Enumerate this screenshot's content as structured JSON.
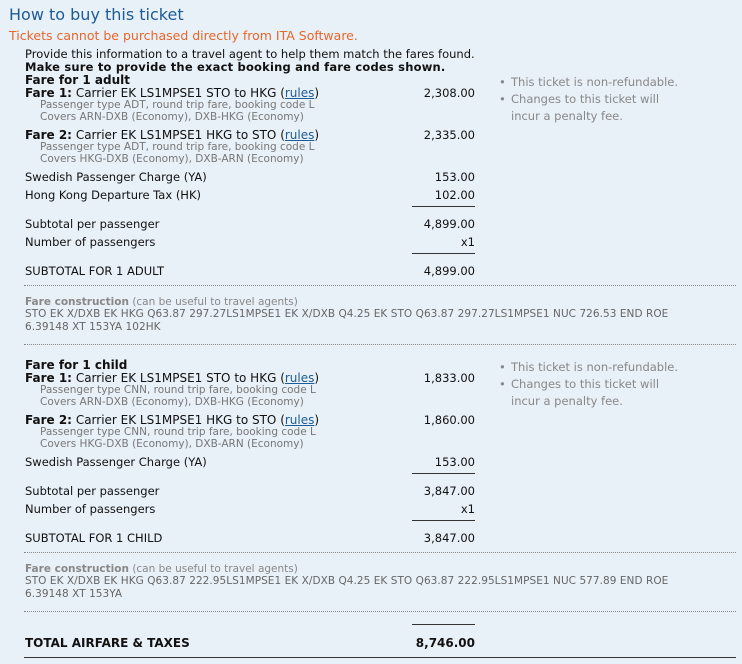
{
  "title": "How to buy this ticket",
  "warning": "Tickets cannot be purchased directly from ITA Software.",
  "intro": {
    "line1": "Provide this information to a travel agent to help them match the fares found.",
    "line2": "Make sure to provide the exact booking and fare codes shown."
  },
  "rules_label": "rules",
  "notes": [
    "This ticket is non-refundable.",
    "Changes to this ticket will incur a penalty fee."
  ],
  "adult": {
    "header": "Fare for 1 adult",
    "fare1": {
      "label": "Fare 1:",
      "text": "Carrier EK LS1MPSE1 STO to HKG",
      "sub1": "Passenger type ADT, round trip fare, booking code L",
      "sub2": "Covers ARN-DXB (Economy), DXB-HKG (Economy)",
      "amount": "2,308.00"
    },
    "fare2": {
      "label": "Fare 2:",
      "text": "Carrier EK LS1MPSE1 HKG to STO",
      "sub1": "Passenger type ADT, round trip fare, booking code L",
      "sub2": "Covers HKG-DXB (Economy), DXB-ARN (Economy)",
      "amount": "2,335.00"
    },
    "taxes": [
      {
        "label": "Swedish Passenger Charge (YA)",
        "amount": "153.00"
      },
      {
        "label": "Hong Kong Departure Tax (HK)",
        "amount": "102.00"
      }
    ],
    "subtotal_label": "Subtotal per passenger",
    "subtotal": "4,899.00",
    "passengers_label": "Number of passengers",
    "passengers": "x1",
    "total_label": "SUBTOTAL FOR 1 ADULT",
    "total": "4,899.00",
    "fc_label": "Fare construction",
    "fc_note": "(can be useful to travel agents)",
    "fc_text": "STO EK X/DXB EK HKG Q63.87 297.27LS1MPSE1 EK X/DXB Q4.25 EK STO Q63.87 297.27LS1MPSE1 NUC 726.53 END ROE 6.39148 XT 153YA 102HK"
  },
  "child": {
    "header": "Fare for 1 child",
    "fare1": {
      "label": "Fare 1:",
      "text": "Carrier EK LS1MPSE1 STO to HKG",
      "sub1": "Passenger type CNN, round trip fare, booking code L",
      "sub2": "Covers ARN-DXB (Economy), DXB-HKG (Economy)",
      "amount": "1,833.00"
    },
    "fare2": {
      "label": "Fare 2:",
      "text": "Carrier EK LS1MPSE1 HKG to STO",
      "sub1": "Passenger type CNN, round trip fare, booking code L",
      "sub2": "Covers HKG-DXB (Economy), DXB-ARN (Economy)",
      "amount": "1,860.00"
    },
    "taxes": [
      {
        "label": "Swedish Passenger Charge (YA)",
        "amount": "153.00"
      }
    ],
    "subtotal_label": "Subtotal per passenger",
    "subtotal": "3,847.00",
    "passengers_label": "Number of passengers",
    "passengers": "x1",
    "total_label": "SUBTOTAL FOR 1 CHILD",
    "total": "3,847.00",
    "fc_label": "Fare construction",
    "fc_note": "(can be useful to travel agents)",
    "fc_text": "STO EK X/DXB EK HKG Q63.87 222.95LS1MPSE1 EK X/DXB Q4.25 EK STO Q63.87 222.95LS1MPSE1 NUC 577.89 END ROE 6.39148 XT 153YA"
  },
  "grand_total_label": "TOTAL AIRFARE & TAXES",
  "grand_total": "8,746.00"
}
